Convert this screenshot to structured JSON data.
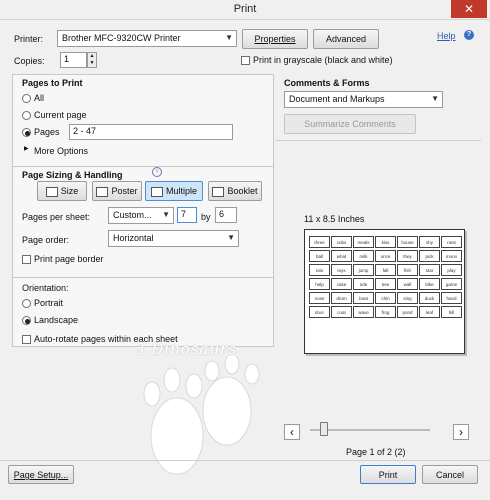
{
  "window": {
    "title": "Print",
    "close_glyph": "✕"
  },
  "printer": {
    "label": "Printer:",
    "value": "Brother MFC-9320CW Printer",
    "properties_label": "Properties",
    "advanced_label": "Advanced",
    "help_label": "Help",
    "help_icon": "?"
  },
  "copies": {
    "label": "Copies:",
    "value": "1",
    "grayscale_label": "Print in grayscale (black and white)"
  },
  "pages_to_print": {
    "title": "Pages to Print",
    "all_label": "All",
    "current_label": "Current page",
    "pages_label": "Pages",
    "pages_value": "2 - 47",
    "more_options_label": "More Options",
    "selected": "pages"
  },
  "sizing": {
    "title": "Page Sizing & Handling",
    "info_icon": "i",
    "tabs": [
      {
        "label": "Size",
        "icon": "size-icon"
      },
      {
        "label": "Poster",
        "icon": "poster-icon"
      },
      {
        "label": "Multiple",
        "icon": "multiple-icon"
      },
      {
        "label": "Booklet",
        "icon": "booklet-icon"
      }
    ],
    "active_tab": "Multiple",
    "pages_per_sheet_label": "Pages per sheet:",
    "pages_per_sheet_value": "Custom...",
    "cols_value": "7",
    "by_label": "by",
    "rows_value": "6",
    "page_order_label": "Page order:",
    "page_order_value": "Horizontal",
    "print_border_label": "Print page border"
  },
  "orientation": {
    "title": "Orientation:",
    "portrait_label": "Portrait",
    "landscape_label": "Landscape",
    "auto_rotate_label": "Auto-rotate pages within each sheet",
    "selected": "landscape"
  },
  "comments": {
    "title": "Comments & Forms",
    "value": "Document and Markups",
    "summarize_label": "Summarize Comments"
  },
  "preview": {
    "size_label": "11 x 8.5 Inches",
    "page_info": "Page 1 of 2 (2)",
    "prev_glyph": "‹",
    "next_glyph": "›",
    "slider_position": 0.0,
    "thumbnail_words": [
      "three",
      "cubs",
      "meals",
      "kiss",
      "house",
      "shy",
      "nest",
      "ball",
      "what",
      "milk",
      "once",
      "they",
      "pick",
      "moon",
      "rain",
      "toys",
      "jump",
      "fall",
      "fish",
      "star",
      "play",
      "help",
      "cake",
      "ride",
      "tree",
      "wall",
      "bike",
      "game",
      "nose",
      "drum",
      "boat",
      "chin",
      "sing",
      "duck",
      "hand",
      "door",
      "coat",
      "wave",
      "frog",
      "pond",
      "leaf",
      "hill"
    ]
  },
  "watermark": {
    "text": "3 Dinosaurs"
  },
  "footer": {
    "page_setup_label": "Page Setup...",
    "print_label": "Print",
    "cancel_label": "Cancel"
  }
}
